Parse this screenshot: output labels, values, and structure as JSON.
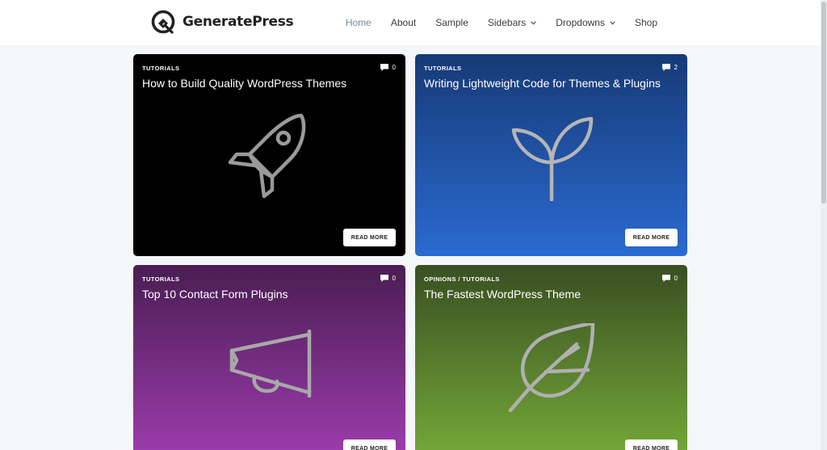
{
  "brand": {
    "name": "GeneratePress"
  },
  "nav": [
    {
      "label": "Home",
      "active": true,
      "dropdown": false
    },
    {
      "label": "About",
      "active": false,
      "dropdown": false
    },
    {
      "label": "Sample",
      "active": false,
      "dropdown": false
    },
    {
      "label": "Sidebars",
      "active": false,
      "dropdown": true
    },
    {
      "label": "Dropdowns",
      "active": false,
      "dropdown": true
    },
    {
      "label": "Shop",
      "active": false,
      "dropdown": false
    }
  ],
  "posts": [
    {
      "category": "TUTORIALS",
      "comments": "0",
      "title": "How to Build Quality WordPress Themes",
      "icon": "rocket-icon",
      "button": "READ MORE",
      "bg": "#000000"
    },
    {
      "category": "TUTORIALS",
      "comments": "2",
      "title": "Writing Lightweight Code for Themes & Plugins",
      "icon": "sprout-icon",
      "button": "READ MORE",
      "bg": "#2a6ad0"
    },
    {
      "category": "TUTORIALS",
      "comments": "0",
      "title": "Top 10 Contact Form Plugins",
      "icon": "megaphone-icon",
      "button": "READ MORE",
      "bg": "#a13eb3"
    },
    {
      "category": "OPINIONS / TUTORIALS",
      "comments": "0",
      "title": "The Fastest WordPress Theme",
      "icon": "leaf-icon",
      "button": "READ MORE",
      "bg": "#77ad3a"
    }
  ],
  "colors": {
    "nav_active": "#7b8a9c",
    "text": "#222222",
    "page_bg": "#f4f6f9"
  }
}
